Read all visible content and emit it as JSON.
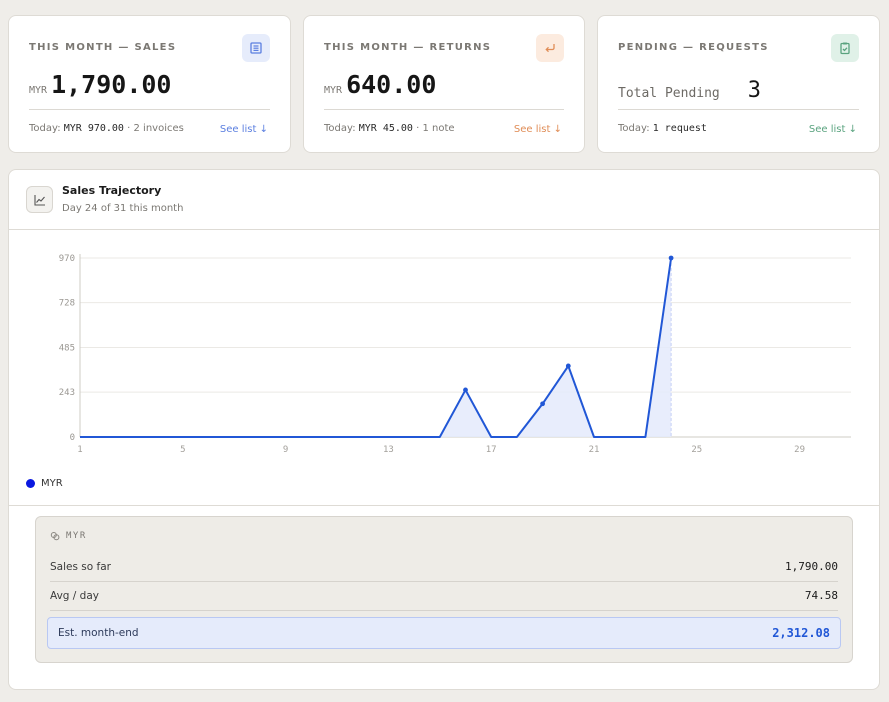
{
  "cards": [
    {
      "label": "THIS MONTH — SALES",
      "currency": "MYR",
      "value": "1,790.00",
      "footer_prefix": "Today:",
      "footer_amount": "MYR 970.00",
      "footer_suffix": "· 2 invoices",
      "link": "See list ↓",
      "icon": "invoice-icon",
      "accent": "#5b7fe0",
      "icon_bg": "#e6ecfb"
    },
    {
      "label": "THIS MONTH — RETURNS",
      "currency": "MYR",
      "value": "640.00",
      "footer_prefix": "Today:",
      "footer_amount": "MYR 45.00",
      "footer_suffix": "· 1 note",
      "link": "See list ↓",
      "icon": "return-arrow-icon",
      "accent": "#e08d57",
      "icon_bg": "#fcebdf"
    },
    {
      "label": "PENDING — REQUESTS",
      "pending_label": "Total Pending",
      "pending_count": "3",
      "footer_prefix": "Today:",
      "footer_amount": "1 request",
      "link": "See list ↓",
      "icon": "clipboard-check-icon",
      "accent": "#5aa37f",
      "icon_bg": "#e0f1e8"
    }
  ],
  "chart_panel": {
    "title": "Sales Trajectory",
    "subtitle": "Day 24 of 31 this month",
    "icon": "trend-chart-icon"
  },
  "chart_data": {
    "type": "area",
    "x_ticks": [
      "1",
      "5",
      "9",
      "13",
      "17",
      "21",
      "25",
      "29"
    ],
    "y_ticks": [
      "0",
      "243",
      "485",
      "728",
      "970"
    ],
    "xlim": [
      1,
      31
    ],
    "ylim": [
      0,
      970
    ],
    "series": [
      {
        "name": "MYR",
        "color": "#2157d6",
        "points": [
          [
            1,
            0
          ],
          [
            2,
            0
          ],
          [
            3,
            0
          ],
          [
            4,
            0
          ],
          [
            5,
            0
          ],
          [
            6,
            0
          ],
          [
            7,
            0
          ],
          [
            8,
            0
          ],
          [
            9,
            0
          ],
          [
            10,
            0
          ],
          [
            11,
            0
          ],
          [
            12,
            0
          ],
          [
            13,
            0
          ],
          [
            14,
            0
          ],
          [
            15,
            0
          ],
          [
            16,
            255
          ],
          [
            17,
            0
          ],
          [
            18,
            0
          ],
          [
            19,
            180
          ],
          [
            20,
            385
          ],
          [
            21,
            0
          ],
          [
            22,
            0
          ],
          [
            23,
            0
          ],
          [
            24,
            970
          ]
        ]
      }
    ],
    "grid": true,
    "legend_position": "bottom-left"
  },
  "legend": {
    "label": "MYR",
    "color": "#0a18e0"
  },
  "summary": {
    "heading": "MYR",
    "rows": [
      {
        "label": "Sales so far",
        "value": "1,790.00"
      },
      {
        "label": "Avg / day",
        "value": "74.58"
      }
    ],
    "estimate": {
      "label": "Est. month-end",
      "value": "2,312.08"
    }
  }
}
